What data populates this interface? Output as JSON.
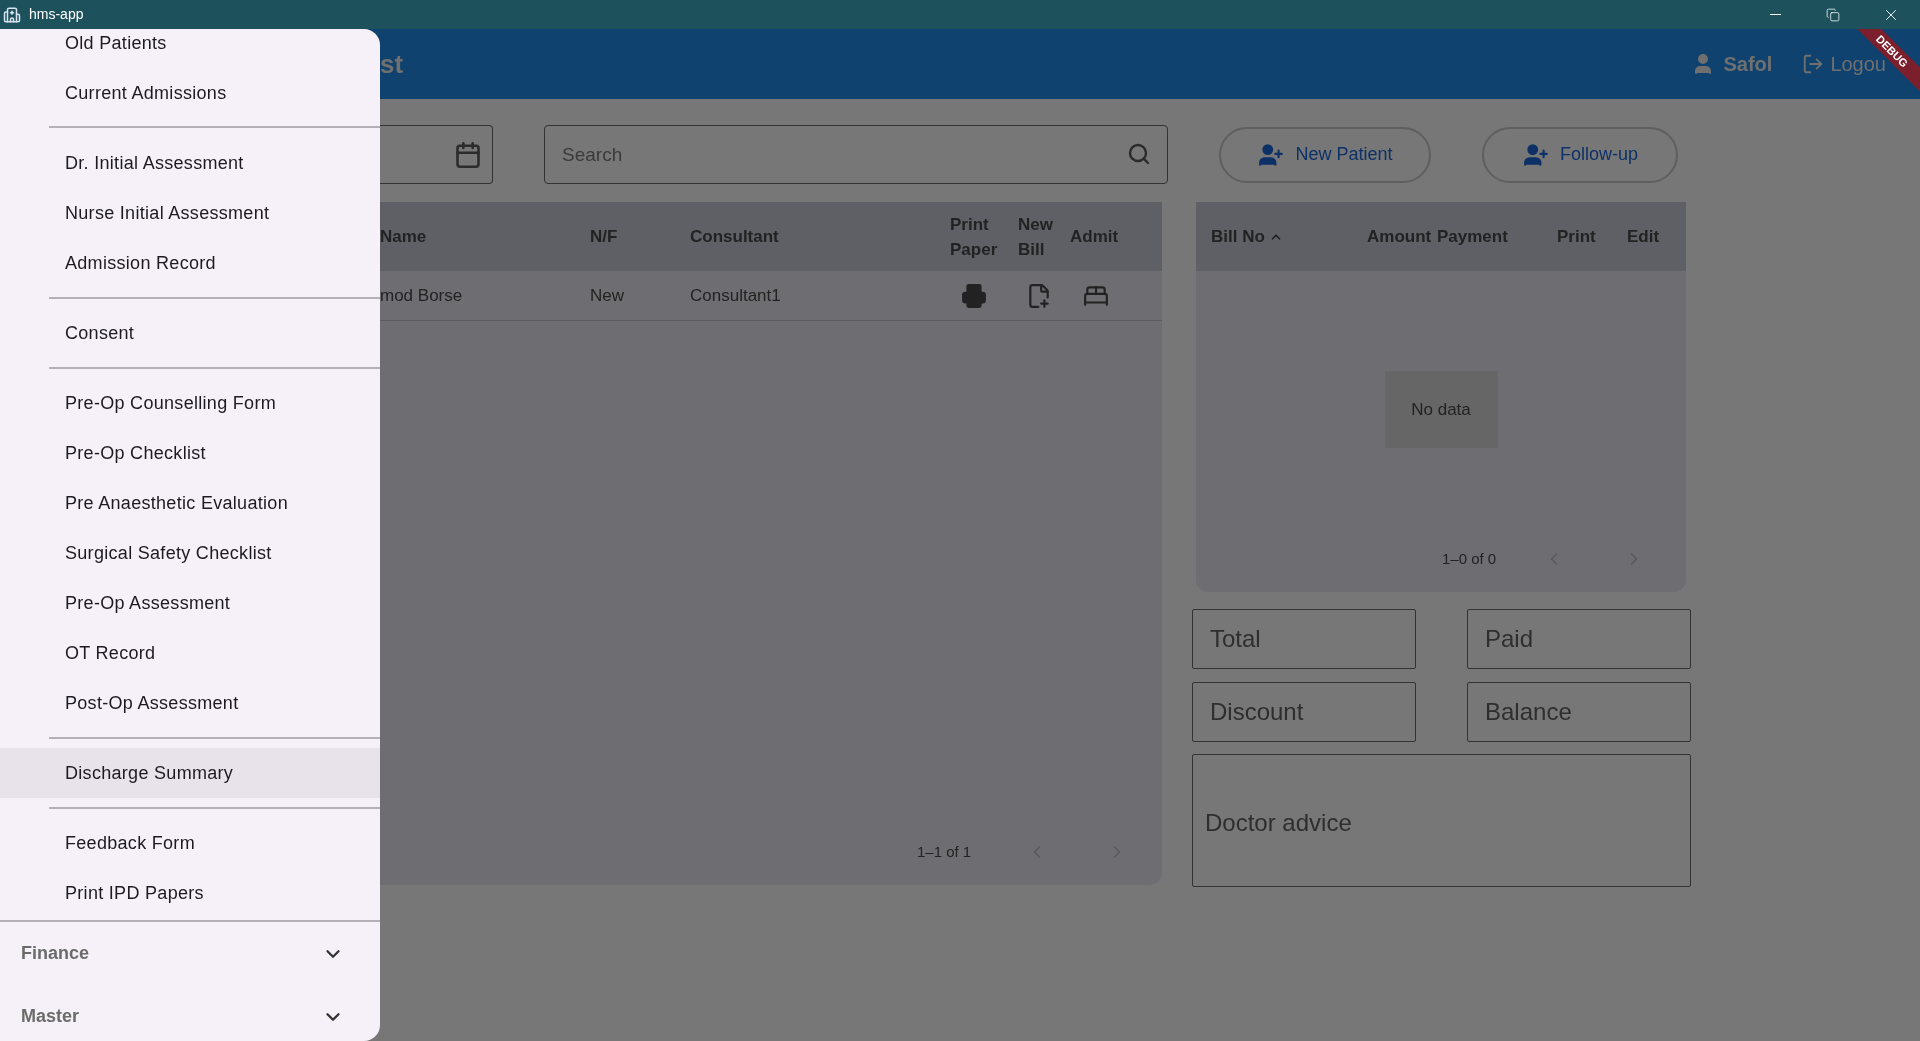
{
  "window": {
    "title": "hms-app"
  },
  "header": {
    "title": "st",
    "user": "Safol",
    "logout": "Logou"
  },
  "debug_banner": "DEBUG",
  "drawer": {
    "groups": [
      {
        "items": [
          {
            "label": "Old Patients",
            "selected": false
          },
          {
            "label": "Current Admissions",
            "selected": false
          }
        ]
      },
      {
        "items": [
          {
            "label": "Dr. Initial Assessment",
            "selected": false
          },
          {
            "label": "Nurse Initial Assessment",
            "selected": false
          },
          {
            "label": "Admission Record",
            "selected": false
          }
        ]
      },
      {
        "items": [
          {
            "label": "Consent",
            "selected": false
          }
        ]
      },
      {
        "items": [
          {
            "label": "Pre-Op Counselling Form",
            "selected": false
          },
          {
            "label": "Pre-Op Checklist",
            "selected": false
          },
          {
            "label": "Pre Anaesthetic Evaluation",
            "selected": false
          },
          {
            "label": "Surgical Safety Checklist",
            "selected": false
          },
          {
            "label": "Pre-Op Assessment",
            "selected": false
          },
          {
            "label": "OT Record",
            "selected": false
          },
          {
            "label": "Post-Op Assessment",
            "selected": false
          }
        ]
      },
      {
        "items": [
          {
            "label": "Discharge Summary",
            "selected": true
          }
        ]
      },
      {
        "items": [
          {
            "label": "Feedback Form",
            "selected": false
          },
          {
            "label": "Print IPD Papers",
            "selected": false
          }
        ]
      }
    ],
    "sections": [
      {
        "label": "Finance",
        "expanded": false
      },
      {
        "label": "Master",
        "expanded": false
      }
    ]
  },
  "search": {
    "placeholder": "Search"
  },
  "buttons": [
    {
      "label": "New Patient"
    },
    {
      "label": "Follow-up"
    }
  ],
  "patients_table": {
    "columns": [
      "Name",
      "N/F",
      "Consultant",
      "Print\nPaper",
      "New\nBill",
      "Admit"
    ],
    "rows": [
      {
        "name": "mod Borse",
        "nf": "New",
        "consultant": "Consultant1"
      }
    ],
    "pagination": "1–1 of 1"
  },
  "bills_table": {
    "columns": [
      {
        "label": "Bill No",
        "sorted": true
      },
      {
        "label": "Amount",
        "sorted": false
      },
      {
        "label": "Payment",
        "sorted": false
      },
      {
        "label": "Print",
        "sorted": false
      },
      {
        "label": "Edit",
        "sorted": false
      }
    ],
    "empty_text": "No data",
    "pagination": "1–0 of 0"
  },
  "fields": [
    {
      "placeholder": "Total"
    },
    {
      "placeholder": "Paid"
    },
    {
      "placeholder": "Discount"
    },
    {
      "placeholder": "Balance"
    }
  ],
  "advice": {
    "placeholder": "Doctor advice"
  }
}
